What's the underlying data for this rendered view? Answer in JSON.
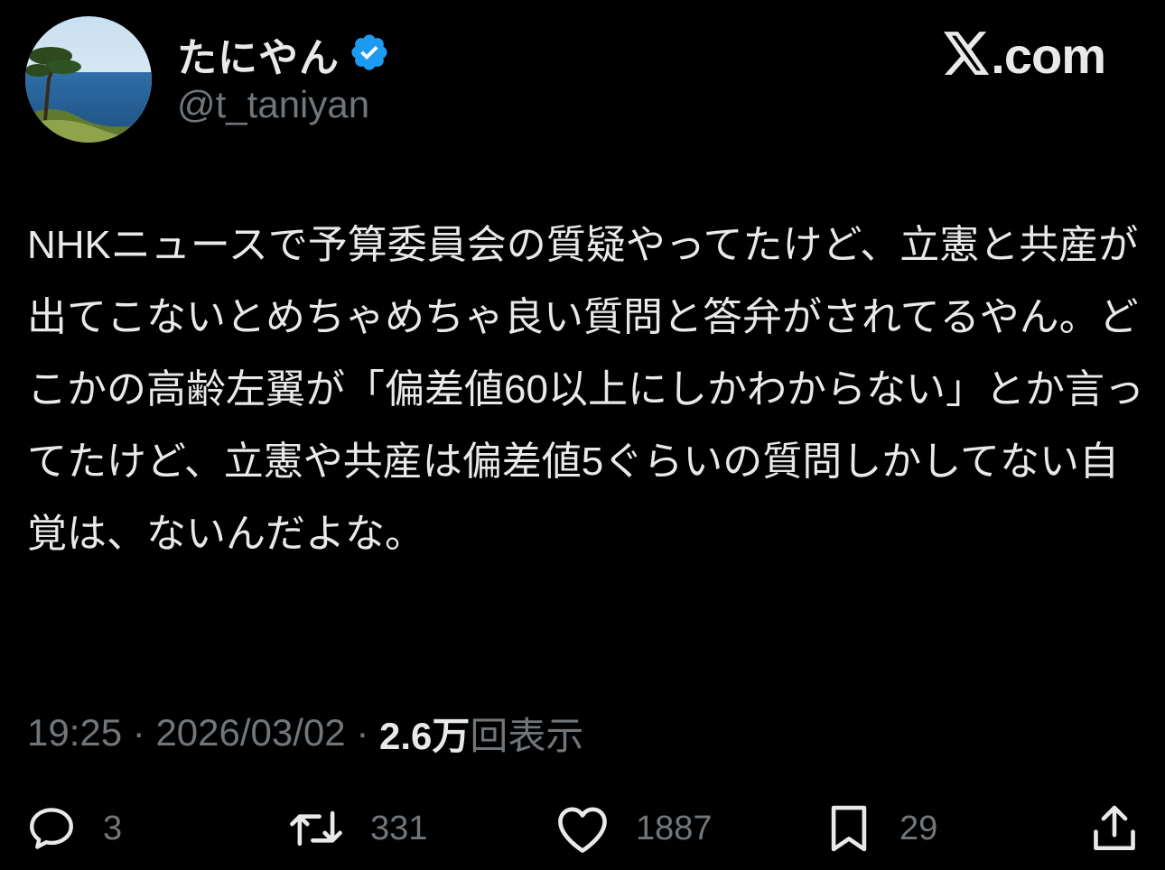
{
  "author": {
    "display_name": "たにやん",
    "handle": "@t_taniyan",
    "verified": true,
    "verified_badge_color": "#1d9bf0",
    "avatar_icon": "avatar-photo-pine-tree-sea"
  },
  "brand": {
    "logo_icon": "x-logo-icon",
    "text": ".com"
  },
  "tweet": {
    "text": "NHKニュースで予算委員会の質疑やってたけど、立憲と共産が出てこないとめちゃめちゃ良い質問と答弁がされてるやん。どこかの高齢左翼が「偏差値60以上にしかわからない」とか言ってたけど、立憲や共産は偏差値5ぐらいの質問しかしてない自覚は、ないんだよな。"
  },
  "meta": {
    "time": "19:25",
    "separator": " · ",
    "date": "2026/03/02",
    "views_count": "2.6万",
    "views_label": "回表示"
  },
  "actions": {
    "reply": {
      "icon": "reply-icon",
      "count": "3"
    },
    "repost": {
      "icon": "repost-icon",
      "count": "331"
    },
    "like": {
      "icon": "heart-icon",
      "count": "1887"
    },
    "bookmark": {
      "icon": "bookmark-icon",
      "count": "29"
    },
    "share": {
      "icon": "share-icon"
    }
  },
  "colors": {
    "background": "#000000",
    "text_primary": "#e7e9ea",
    "text_secondary": "#71767b"
  }
}
